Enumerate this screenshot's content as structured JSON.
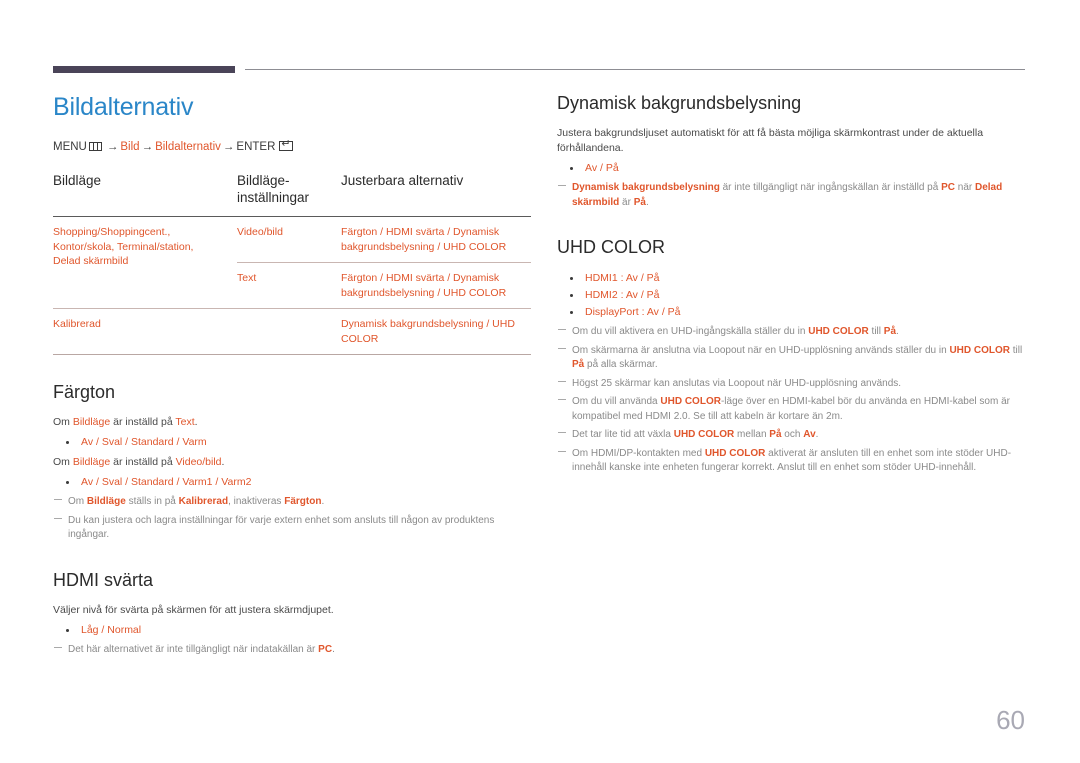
{
  "header": {
    "accent_color": "#4a4458",
    "rule_color": "#8d8d93"
  },
  "colors": {
    "title_blue": "#2a86c8",
    "highlight_orange": "#e0562c",
    "note_gray": "#8a8a8a"
  },
  "left": {
    "title": "Bildalternativ",
    "breadcrumb": {
      "menu_label": "MENU",
      "menu_icon": "menu-grid-icon",
      "arrow1": "→",
      "item1": "Bild",
      "arrow2": "→",
      "item2": "Bildalternativ",
      "arrow3": "→",
      "enter_label": "ENTER",
      "enter_icon": "enter-key-icon"
    },
    "table": {
      "headers": [
        "Bildläge",
        "Bildläge-\ninsträllningar",
        "Justerbara alternativ"
      ],
      "header_col1": "Bildläge",
      "header_col2_line1": "Bildläge-",
      "header_col2_line2": "inställningar",
      "header_col3": "Justerbara alternativ",
      "rows": [
        {
          "mode": "Shopping/Shoppingcent.,\nKontor/skola, Terminal/station,\nDelad skärmbild",
          "mode_l1": "Shopping/Shoppingcent.,",
          "mode_l2": "Kontor/skola, Terminal/station,",
          "mode_l3": "Delad skärmbild",
          "setting": "Video/bild",
          "options": "Färgton / HDMI svärta / Dynamisk bakgrundsbelysning / UHD COLOR"
        },
        {
          "mode": "",
          "setting": "Text",
          "options": "Färgton / HDMI svärta / Dynamisk bakgrundsbelysning / UHD COLOR"
        },
        {
          "mode": "Kalibrerad",
          "setting": "",
          "options": "Dynamisk bakgrundsbelysning / UHD COLOR"
        }
      ]
    },
    "fargton": {
      "heading": "Färgton",
      "line1_a": "Om ",
      "line1_b": "Bildläge",
      "line1_c": " är inställd på ",
      "line1_d": "Text",
      "line1_e": ".",
      "bullet1": "Av / Sval / Standard / Varm",
      "line2_a": "Om ",
      "line2_b": "Bildläge",
      "line2_c": " är inställd på ",
      "line2_d": "Video/bild",
      "line2_e": ".",
      "bullet2": "Av / Sval / Standard / Varm1 / Varm2",
      "note1_a": "Om ",
      "note1_b": "Bildläge",
      "note1_c": " ställs in på ",
      "note1_d": "Kalibrerad",
      "note1_e": ", inaktiveras ",
      "note1_f": "Färgton",
      "note1_g": ".",
      "note2": "Du kan justera och lagra inställningar för varje extern enhet som ansluts till någon av produktens ingångar."
    },
    "hdmi_svarta": {
      "heading": "HDMI svärta",
      "description": "Väljer nivå för svärta på skärmen för att justera skärmdjupet.",
      "bullet1": "Låg / Normal",
      "note1_a": "Det här alternativet är inte tillgängligt när indatakällan är ",
      "note1_b": "PC",
      "note1_c": "."
    }
  },
  "right": {
    "dynbacklight": {
      "heading": "Dynamisk bakgrundsbelysning",
      "description": "Justera bakgrundsljuset automatiskt för att få bästa möjliga skärmkontrast under de aktuella förhållandena.",
      "bullet1": "Av / På",
      "note1_a": "Dynamisk bakgrundsbelysning",
      "note1_b": " är inte tillgängligt när ingångskällan är inställd på ",
      "note1_c": "PC",
      "note1_d": " när ",
      "note1_e": "Delad skärmbild",
      "note1_f": " är ",
      "note1_g": "På",
      "note1_h": "."
    },
    "uhd_color": {
      "heading": "UHD COLOR",
      "bullets": [
        "HDMI1 : Av / På",
        "HDMI2 : Av / På",
        "DisplayPort : Av / På"
      ],
      "bullet1": "HDMI1 : Av / På",
      "bullet2": "HDMI2 : Av / På",
      "bullet3": "DisplayPort : Av / På",
      "note1_a": "Om du vill aktivera en UHD-ingångskälla ställer du in ",
      "note1_b": "UHD COLOR",
      "note1_c": " till ",
      "note1_d": "På",
      "note1_e": ".",
      "note2_a": "Om skärmarna är anslutna via Loopout när en UHD-upplösning används ställer du in ",
      "note2_b": "UHD COLOR",
      "note2_c": " till ",
      "note2_d": "På",
      "note2_e": " på alla skärmar.",
      "note3": "Högst 25 skärmar kan anslutas via Loopout när UHD-upplösning används.",
      "note4_a": "Om du vill använda ",
      "note4_b": "UHD COLOR",
      "note4_c": "-läge över en HDMI-kabel bör du använda en HDMI-kabel som är kompatibel med HDMI 2.0. Se till att kabeln är kortare än 2m.",
      "note5_a": "Det tar lite tid att växla ",
      "note5_b": "UHD COLOR",
      "note5_c": " mellan ",
      "note5_d": "På",
      "note5_e": " och ",
      "note5_f": "Av",
      "note5_g": ".",
      "note6_a": "Om HDMI/DP-kontakten med ",
      "note6_b": "UHD COLOR",
      "note6_c": " aktiverat är ansluten till en enhet som inte stöder UHD-innehåll kanske inte enheten fungerar korrekt. Anslut till en enhet som stöder UHD-innehåll."
    }
  },
  "footer": {
    "page_number": "60"
  }
}
